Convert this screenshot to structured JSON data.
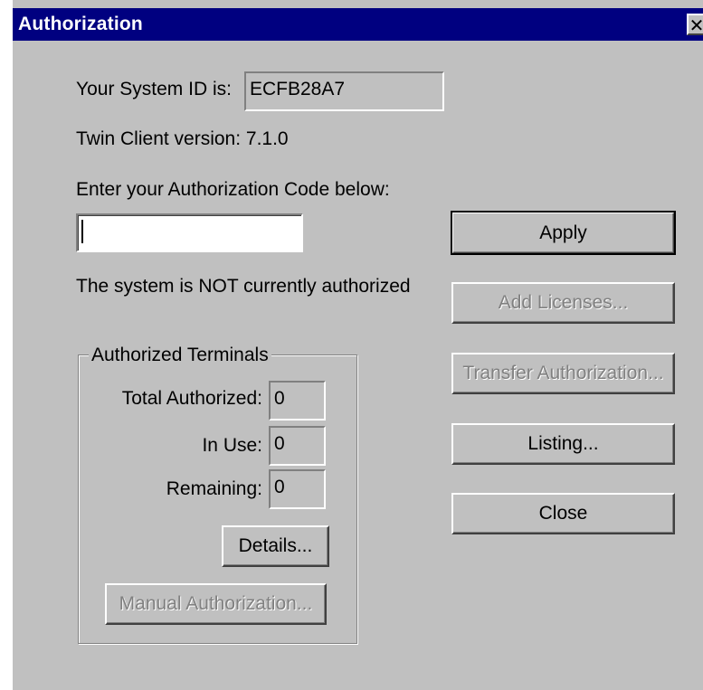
{
  "window": {
    "title": "Authorization",
    "close_glyph": "✕"
  },
  "system": {
    "id_label": "Your System ID is:",
    "id_value": "ECFB28A7",
    "version_text": "Twin Client version: 7.1.0"
  },
  "auth_code": {
    "prompt": "Enter your Authorization Code below:",
    "value": "",
    "status_text": "The system is NOT currently authorized"
  },
  "terminals": {
    "group_title": "Authorized Terminals",
    "total_label": "Total Authorized:",
    "total_value": "0",
    "in_use_label": "In Use:",
    "in_use_value": "0",
    "remaining_label": "Remaining:",
    "remaining_value": "0"
  },
  "buttons": {
    "apply": "Apply",
    "add_licenses": "Add Licenses...",
    "transfer": "Transfer Authorization...",
    "listing": "Listing...",
    "close": "Close",
    "details": "Details...",
    "manual": "Manual Authorization..."
  }
}
